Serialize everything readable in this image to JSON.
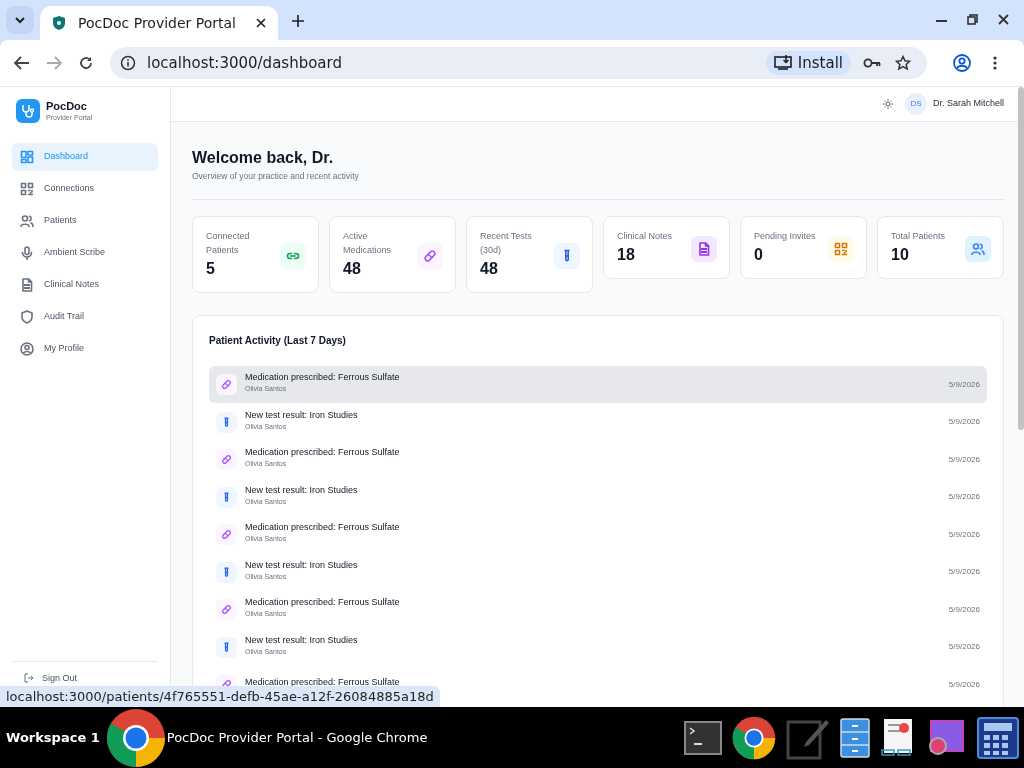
{
  "browser": {
    "tab_title": "PocDoc Provider Portal",
    "url": "localhost:3000/dashboard",
    "install_label": "Install",
    "status_url": "localhost:3000/patients/4f765551-defb-45ae-a12f-26084885a18d"
  },
  "sidebar": {
    "brand": "PocDoc",
    "subtitle": "Provider Portal",
    "items": [
      {
        "label": "Dashboard",
        "kind": "grid",
        "selected": true
      },
      {
        "label": "Connections",
        "kind": "qr",
        "selected": false
      },
      {
        "label": "Patients",
        "kind": "users",
        "selected": false
      },
      {
        "label": "Ambient Scribe",
        "kind": "mic",
        "selected": false
      },
      {
        "label": "Clinical Notes",
        "kind": "doc",
        "selected": false
      },
      {
        "label": "Audit Trail",
        "kind": "shield",
        "selected": false
      },
      {
        "label": "My Profile",
        "kind": "profile",
        "selected": false
      }
    ],
    "sign_out": "Sign Out"
  },
  "header": {
    "initials": "DS",
    "user_name": "Dr. Sarah Mitchell"
  },
  "page": {
    "title": "Welcome back, Dr.",
    "subtitle": "Overview of your practice and recent activity"
  },
  "stats": [
    {
      "label": "Connected Patients",
      "value": "5",
      "kind": "link",
      "color": "#16a34a"
    },
    {
      "label": "Active Medications",
      "value": "48",
      "kind": "pill",
      "color": "#a855f7"
    },
    {
      "label": "Recent Tests (30d)",
      "value": "48",
      "kind": "tube",
      "color": "#2563eb"
    },
    {
      "label": "Clinical Notes",
      "value": "18",
      "kind": "doc",
      "color": "#9333ea"
    },
    {
      "label": "Pending Invites",
      "value": "0",
      "kind": "qr",
      "color": "#d97706"
    },
    {
      "label": "Total Patients",
      "value": "10",
      "kind": "users",
      "color": "#3b82f6"
    }
  ],
  "activity": {
    "title": "Patient Activity (Last 7 Days)",
    "items": [
      {
        "kind": "medication",
        "title": "Medication prescribed: Ferrous Sulfate",
        "patient": "Olivia Santos",
        "date": "5/9/2026",
        "hovered": true
      },
      {
        "kind": "test",
        "title": "New test result: Iron Studies",
        "patient": "Olivia Santos",
        "date": "5/9/2026",
        "hovered": false
      },
      {
        "kind": "medication",
        "title": "Medication prescribed: Ferrous Sulfate",
        "patient": "Olivia Santos",
        "date": "5/9/2026",
        "hovered": false
      },
      {
        "kind": "test",
        "title": "New test result: Iron Studies",
        "patient": "Olivia Santos",
        "date": "5/9/2026",
        "hovered": false
      },
      {
        "kind": "medication",
        "title": "Medication prescribed: Ferrous Sulfate",
        "patient": "Olivia Santos",
        "date": "5/9/2026",
        "hovered": false
      },
      {
        "kind": "test",
        "title": "New test result: Iron Studies",
        "patient": "Olivia Santos",
        "date": "5/9/2026",
        "hovered": false
      },
      {
        "kind": "medication",
        "title": "Medication prescribed: Ferrous Sulfate",
        "patient": "Olivia Santos",
        "date": "5/9/2026",
        "hovered": false
      },
      {
        "kind": "test",
        "title": "New test result: Iron Studies",
        "patient": "Olivia Santos",
        "date": "5/9/2026",
        "hovered": false
      },
      {
        "kind": "medication",
        "title": "Medication prescribed: Ferrous Sulfate",
        "date": "5/9/2026",
        "hovered": false
      }
    ]
  },
  "taskbar": {
    "workspace": "Workspace 1",
    "window_title": "PocDoc Provider Portal - Google Chrome"
  }
}
